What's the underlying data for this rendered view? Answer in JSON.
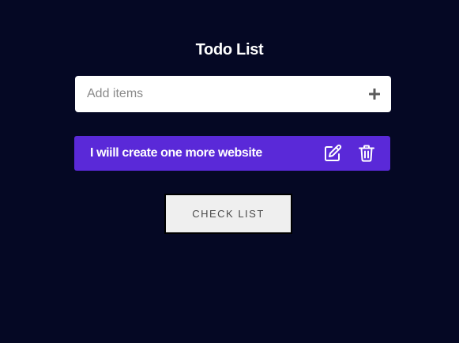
{
  "header": {
    "title": "Todo List"
  },
  "add_item": {
    "placeholder": "Add items",
    "value": "",
    "add_icon": "plus-icon"
  },
  "todo_items": [
    {
      "text": "I wiill create one more website",
      "edit_icon": "edit-icon",
      "delete_icon": "trash-icon"
    }
  ],
  "actions": {
    "check_list_label": "CHECK LIST"
  },
  "colors": {
    "background": "#050824",
    "item_background": "#5a29d8",
    "input_background": "#ffffff",
    "button_background": "#efefef"
  }
}
